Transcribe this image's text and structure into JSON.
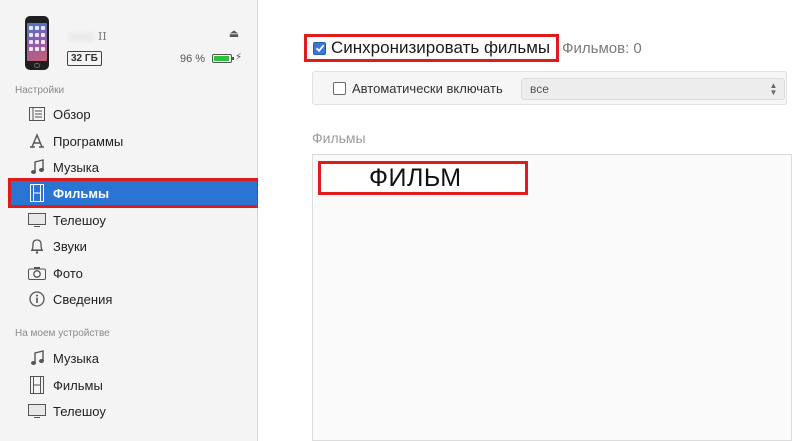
{
  "device": {
    "name": "II",
    "capacity": "32 ГБ",
    "battery_percent": "96 %",
    "battery_level": 0.96,
    "eject_icon": "eject-icon",
    "charge_icon": "charging-bolt-icon"
  },
  "sidebar": {
    "settings_title": "Настройки",
    "settings_items": [
      {
        "label": "Обзор",
        "icon": "summary-list-icon"
      },
      {
        "label": "Программы",
        "icon": "apps-icon"
      },
      {
        "label": "Музыка",
        "icon": "music-note-icon"
      },
      {
        "label": "Фильмы",
        "icon": "film-icon",
        "active": true
      },
      {
        "label": "Телешоу",
        "icon": "tv-icon"
      },
      {
        "label": "Звуки",
        "icon": "bell-icon"
      },
      {
        "label": "Фото",
        "icon": "camera-icon"
      },
      {
        "label": "Сведения",
        "icon": "info-icon"
      }
    ],
    "device_title": "На моем устройстве",
    "device_items": [
      {
        "label": "Музыка",
        "icon": "music-note-icon"
      },
      {
        "label": "Фильмы",
        "icon": "film-icon"
      },
      {
        "label": "Телешоу",
        "icon": "tv-icon"
      }
    ]
  },
  "main": {
    "sync_label": "Синхронизировать фильмы",
    "sync_checked": true,
    "movie_count": "Фильмов: 0",
    "auto_include_label": "Автоматически включать",
    "auto_include_checked": false,
    "auto_include_value": "все",
    "films_heading": "Фильмы",
    "film_entry": "ФИЛЬМ"
  },
  "colors": {
    "accent": "#2a74d4",
    "highlight": "#e01b1b",
    "battery": "#2ac43a"
  }
}
